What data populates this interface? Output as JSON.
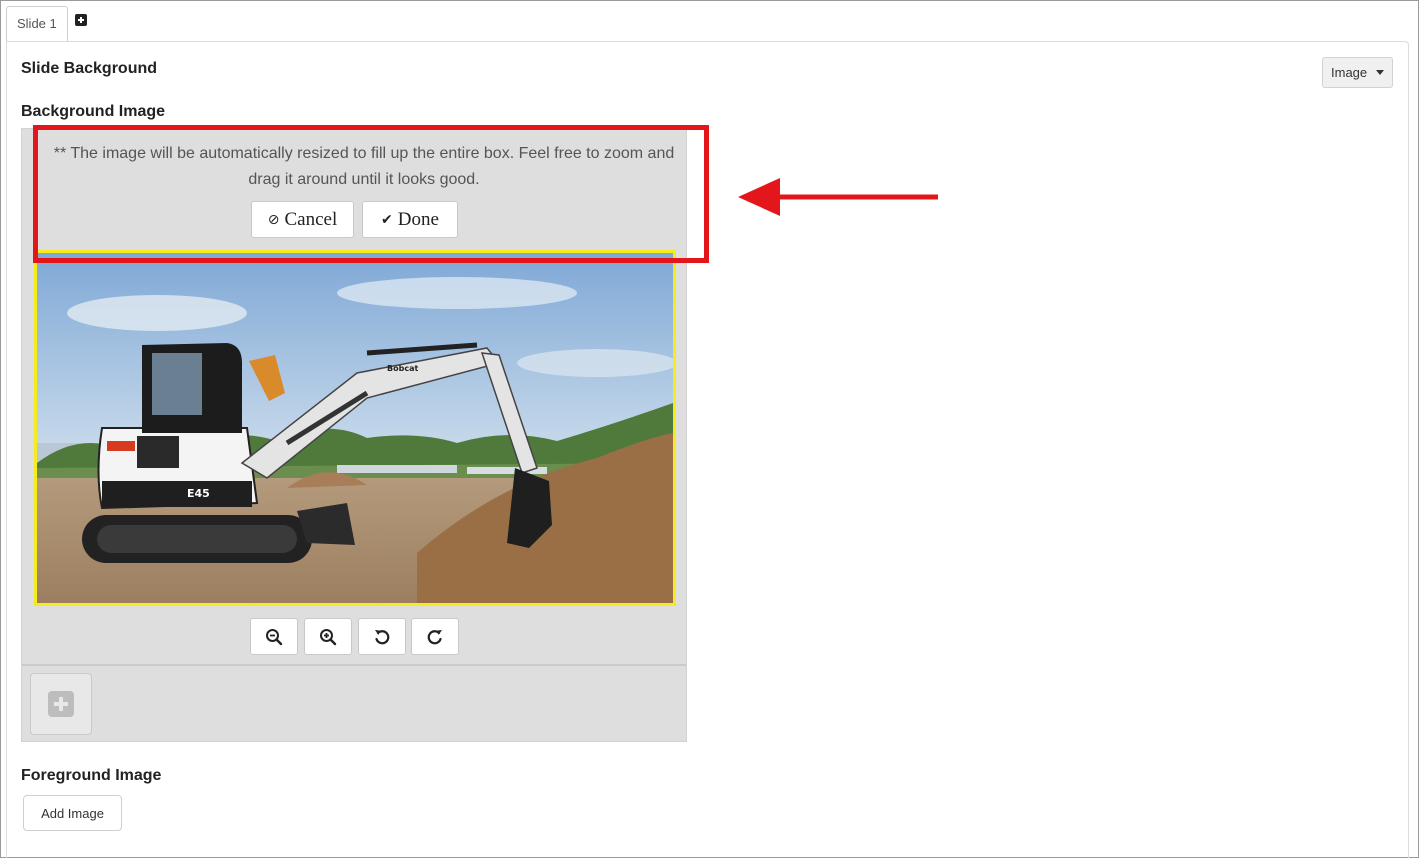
{
  "tabs": {
    "items": [
      {
        "label": "Slide 1"
      }
    ]
  },
  "slide_background": {
    "title": "Slide Background",
    "type_select": {
      "value": "Image"
    }
  },
  "background_image": {
    "title": "Background Image",
    "note": "** The image will be automatically resized to fill up the entire box. Feel free to zoom and drag it around until it looks good.",
    "cancel_label": "Cancel",
    "done_label": "Done",
    "photo": {
      "model_label": "E45",
      "brand_label": "Bobcat"
    },
    "tools": [
      "zoom-out-icon",
      "zoom-in-icon",
      "rotate-left-icon",
      "rotate-right-icon"
    ]
  },
  "foreground_image": {
    "title": "Foreground Image",
    "add_label": "Add Image"
  },
  "colors": {
    "highlight": "#e3171b",
    "crop_border": "#f4ec1c",
    "editor_bg": "#dedede"
  }
}
